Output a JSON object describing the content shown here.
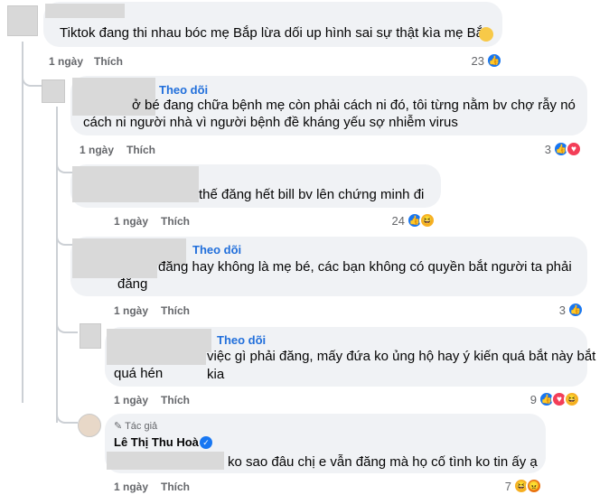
{
  "comments": [
    {
      "text": "Tiktok đang thi nhau bóc mẹ Bắp lừa dối up hình sai sự thật kìa mẹ Bắp",
      "time": "1 ngày",
      "like_label": "Thích",
      "reaction_count": "23"
    },
    {
      "follow_label": "Theo dõi",
      "line1": "ở bé đang chữa bệnh mẹ còn phải cách ni đó, tôi từng nằm bv chợ rẫy nó",
      "line2": "cách ni người nhà vì người bệnh đề kháng yếu sợ nhiễm virus",
      "time": "1 ngày",
      "like_label": "Thích",
      "reaction_count": "3"
    },
    {
      "text": "thế đăng hết bill bv lên chứng minh đi",
      "time": "1 ngày",
      "like_label": "Thích",
      "reaction_count": "24"
    },
    {
      "follow_label": "Theo dõi",
      "line1": "đăng hay không là mẹ bé, các bạn không có quyền bắt người ta phải",
      "line2": "đăng",
      "time": "1 ngày",
      "like_label": "Thích",
      "reaction_count": "3"
    },
    {
      "follow_label": "Theo dõi",
      "line1": "việc gì phải đăng, mấy đứa ko ủng hộ hay ý kiến quá bắt này bắt kia",
      "line2": "quá hén",
      "time": "1 ngày",
      "like_label": "Thích",
      "reaction_count": "9"
    },
    {
      "author_tag": "Tác giả",
      "author_name": "Lê Thị Thu Hoà",
      "text": "ko sao đâu chị e vẫn đăng mà họ cố tình ko tin ấy ạ",
      "time": "1 ngày",
      "like_label": "Thích",
      "reaction_count": "7"
    }
  ],
  "colors": {
    "bubble": "#f0f2f5",
    "link": "#216fdb",
    "meta": "#65676b",
    "like": "#1877f2",
    "heart": "#f33e58",
    "haha": "#f7b125"
  }
}
